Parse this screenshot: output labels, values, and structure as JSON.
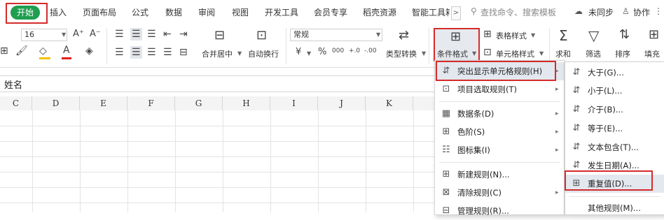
{
  "tabs": {
    "home": "开始",
    "items": [
      "插入",
      "页面布局",
      "公式",
      "数据",
      "审阅",
      "视图",
      "开发工具",
      "会员专享",
      "稻壳资源",
      "智能工具箱"
    ],
    "more": ">",
    "search_placeholder": "查找命令、搜索模板",
    "sync": "未同步",
    "collab": "协作"
  },
  "ribbon": {
    "font_size": "16",
    "font_grow": "A⁺",
    "font_shrink": "A⁻",
    "number_format": "常规",
    "merge_center": "合并居中",
    "wrap_text": "自动换行",
    "currency_symbol": "¥",
    "percent_symbol": "%",
    "thousands_symbol": "000",
    "inc_decimal": "+.0",
    "dec_decimal": "-.00",
    "type_convert": "类型转换",
    "conditional_format": "条件格式",
    "table_style": "表格样式",
    "cell_style": "单元格样式",
    "sum": "求和",
    "filter": "筛选",
    "sort": "排序",
    "fill": "填充"
  },
  "name_cell": "姓名",
  "columns": [
    "C",
    "D",
    "E",
    "F",
    "G",
    "H",
    "I",
    "J",
    "K"
  ],
  "menu1": {
    "items": [
      {
        "label": "突出显示单元格规则(H)",
        "icon": "highlight-rules-icon",
        "submenu": true
      },
      {
        "label": "项目选取规则(T)",
        "icon": "top-rules-icon",
        "submenu": true
      },
      {
        "label": "数据条(D)",
        "icon": "data-bars-icon",
        "submenu": true
      },
      {
        "label": "色阶(S)",
        "icon": "color-scale-icon",
        "submenu": true
      },
      {
        "label": "图标集(I)",
        "icon": "icon-sets-icon",
        "submenu": true
      },
      {
        "label": "新建规则(N)...",
        "icon": "new-rule-icon",
        "submenu": false
      },
      {
        "label": "清除规则(C)",
        "icon": "clear-rules-icon",
        "submenu": true
      },
      {
        "label": "管理规则(R)...",
        "icon": "manage-rules-icon",
        "submenu": false
      }
    ]
  },
  "menu2": {
    "items": [
      {
        "label": "大于(G)...",
        "icon": "greater-than-icon"
      },
      {
        "label": "小于(L)...",
        "icon": "less-than-icon"
      },
      {
        "label": "介于(B)...",
        "icon": "between-icon"
      },
      {
        "label": "等于(E)...",
        "icon": "equal-icon"
      },
      {
        "label": "文本包含(T)...",
        "icon": "text-contains-icon"
      },
      {
        "label": "发生日期(A)...",
        "icon": "date-occurring-icon"
      },
      {
        "label": "重复值(D)...",
        "icon": "duplicate-values-icon"
      },
      {
        "label": "其他规则(M)...",
        "icon": "other-rules-icon"
      }
    ]
  },
  "colors": {
    "highlight": "#d42b2b",
    "home_pill": "#1e9e4f",
    "font_color_bar": "#e02020",
    "fill_color_bar": "#f3c200"
  }
}
